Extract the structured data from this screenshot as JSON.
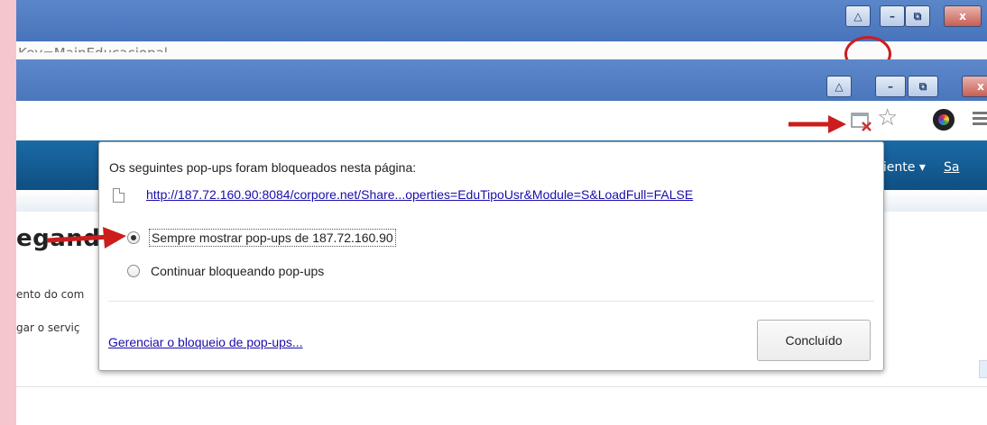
{
  "background_window": {
    "url_text": "Key=MainEducacional",
    "buttons": [
      "△",
      "–",
      "⧉",
      "x"
    ]
  },
  "foreground_window": {
    "buttons": [
      "△",
      "–",
      "⧉",
      "x"
    ]
  },
  "page": {
    "nav_ambiente": "biente ▾",
    "nav_sa": "Sa",
    "heading_partial": "egand",
    "line1_partial": "ento do com",
    "line2_partial": "gar o serviç"
  },
  "popup": {
    "heading": "Os seguintes pop-ups foram bloqueados nesta página:",
    "blocked_url": "http://187.72.160.90:8084/corpore.net/Share...operties=EduTipoUsr&Module=S&LoadFull=FALSE",
    "option_always": "Sempre mostrar pop-ups de 187.72.160.90",
    "option_block": "Continuar bloqueando pop-ups",
    "manage_link": "Gerenciar o bloqueio de pop-ups...",
    "done_button": "Concluído",
    "selected_option": "option_always"
  },
  "icons": {
    "popup_blocked": "popup-blocked-icon",
    "bookmark": "star-icon",
    "extension": "extension-icon",
    "menu": "menu-icon",
    "document": "document-icon"
  },
  "colors": {
    "annotation_red": "#cc1d1d",
    "titlebar_blue": "#4a76bd",
    "nav_blue": "#0f4f83",
    "link_blue": "#1a0dab",
    "page_background": "#f5c6cb"
  }
}
